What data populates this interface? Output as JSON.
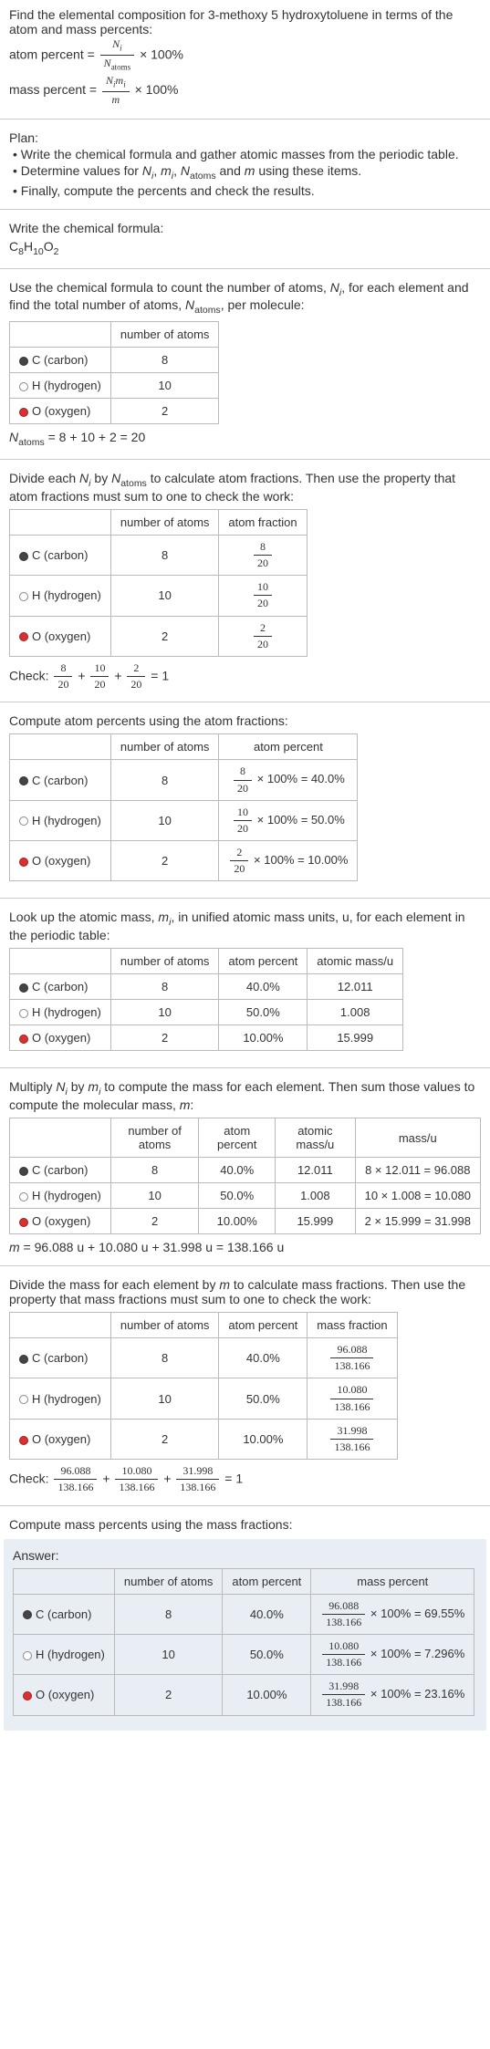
{
  "intro": {
    "line1": "Find the elemental composition for 3-methoxy 5 hydroxytoluene in terms of the atom and mass percents:",
    "atom_percent_label": "atom percent = ",
    "atom_percent_times": " × 100%",
    "mass_percent_label": "mass percent = ",
    "mass_percent_times": " × 100%",
    "Ni": "N",
    "Ni_sub": "i",
    "Natoms": "N",
    "Natoms_sub": "atoms",
    "Nimi_top": "N",
    "Nimi_top_sub": "i",
    "Nimi_top2": "m",
    "Nimi_top2_sub": "i",
    "m": "m"
  },
  "plan": {
    "title": "Plan:",
    "b1": "• Write the chemical formula and gather atomic masses from the periodic table.",
    "b2_a": "• Determine values for ",
    "b2_b": " using these items.",
    "b3": "• Finally, compute the percents and check the results."
  },
  "write_formula": {
    "title": "Write the chemical formula:",
    "formula_c": "C",
    "formula_c_n": "8",
    "formula_h": "H",
    "formula_h_n": "10",
    "formula_o": "O",
    "formula_o_n": "2"
  },
  "count_atoms": {
    "text_a": "Use the chemical formula to count the number of atoms, ",
    "text_b": ", for each element and find the total number of atoms, ",
    "text_c": ", per molecule:",
    "header_num": "number of atoms",
    "rows": [
      {
        "el": "C (carbon)",
        "n": "8"
      },
      {
        "el": "H (hydrogen)",
        "n": "10"
      },
      {
        "el": "O (oxygen)",
        "n": "2"
      }
    ],
    "sum_label": " = 8 + 10 + 2 = 20"
  },
  "atom_frac": {
    "text_a": "Divide each ",
    "text_b": " by ",
    "text_c": " to calculate atom fractions. Then use the property that atom fractions must sum to one to check the work:",
    "header_num": "number of atoms",
    "header_frac": "atom fraction",
    "rows": [
      {
        "el": "C (carbon)",
        "n": "8",
        "num": "8",
        "den": "20"
      },
      {
        "el": "H (hydrogen)",
        "n": "10",
        "num": "10",
        "den": "20"
      },
      {
        "el": "O (oxygen)",
        "n": "2",
        "num": "2",
        "den": "20"
      }
    ],
    "check_label": "Check: ",
    "check_eq": " = 1"
  },
  "atom_pct": {
    "title": "Compute atom percents using the atom fractions:",
    "header_num": "number of atoms",
    "header_pct": "atom percent",
    "rows": [
      {
        "el": "C (carbon)",
        "n": "8",
        "num": "8",
        "den": "20",
        "res": " × 100% = 40.0%"
      },
      {
        "el": "H (hydrogen)",
        "n": "10",
        "num": "10",
        "den": "20",
        "res": " × 100% = 50.0%"
      },
      {
        "el": "O (oxygen)",
        "n": "2",
        "num": "2",
        "den": "20",
        "res": " × 100% = 10.00%"
      }
    ]
  },
  "atomic_mass": {
    "text_a": "Look up the atomic mass, ",
    "text_b": ", in unified atomic mass units, u, for each element in the periodic table:",
    "header_num": "number of atoms",
    "header_pct": "atom percent",
    "header_mass": "atomic mass/u",
    "rows": [
      {
        "el": "C (carbon)",
        "n": "8",
        "pct": "40.0%",
        "mass": "12.011"
      },
      {
        "el": "H (hydrogen)",
        "n": "10",
        "pct": "50.0%",
        "mass": "1.008"
      },
      {
        "el": "O (oxygen)",
        "n": "2",
        "pct": "10.00%",
        "mass": "15.999"
      }
    ]
  },
  "mass_calc": {
    "text_a": "Multiply ",
    "text_b": " by ",
    "text_c": " to compute the mass for each element. Then sum those values to compute the molecular mass, ",
    "text_d": ":",
    "header_num": "number of atoms",
    "header_pct": "atom percent",
    "header_amass": "atomic mass/u",
    "header_massu": "mass/u",
    "rows": [
      {
        "el": "C (carbon)",
        "n": "8",
        "pct": "40.0%",
        "amass": "12.011",
        "calc": "8 × 12.011 = 96.088"
      },
      {
        "el": "H (hydrogen)",
        "n": "10",
        "pct": "50.0%",
        "amass": "1.008",
        "calc": "10 × 1.008 = 10.080"
      },
      {
        "el": "O (oxygen)",
        "n": "2",
        "pct": "10.00%",
        "amass": "15.999",
        "calc": "2 × 15.999 = 31.998"
      }
    ],
    "sum": " = 96.088 u + 10.080 u + 31.998 u = 138.166 u"
  },
  "mass_frac": {
    "text_a": "Divide the mass for each element by ",
    "text_b": " to calculate mass fractions. Then use the property that mass fractions must sum to one to check the work:",
    "header_num": "number of atoms",
    "header_pct": "atom percent",
    "header_frac": "mass fraction",
    "rows": [
      {
        "el": "C (carbon)",
        "n": "8",
        "pct": "40.0%",
        "num": "96.088",
        "den": "138.166"
      },
      {
        "el": "H (hydrogen)",
        "n": "10",
        "pct": "50.0%",
        "num": "10.080",
        "den": "138.166"
      },
      {
        "el": "O (oxygen)",
        "n": "2",
        "pct": "10.00%",
        "num": "31.998",
        "den": "138.166"
      }
    ],
    "check_label": "Check: ",
    "check_eq": " = 1"
  },
  "final": {
    "title": "Compute mass percents using the mass fractions:",
    "answer_label": "Answer:",
    "header_num": "number of atoms",
    "header_pct": "atom percent",
    "header_mass": "mass percent",
    "rows": [
      {
        "el": "C (carbon)",
        "n": "8",
        "pct": "40.0%",
        "num": "96.088",
        "den": "138.166",
        "res": " × 100% = 69.55%"
      },
      {
        "el": "H (hydrogen)",
        "n": "10",
        "pct": "50.0%",
        "num": "10.080",
        "den": "138.166",
        "res": " × 100% = 7.296%"
      },
      {
        "el": "O (oxygen)",
        "n": "2",
        "pct": "10.00%",
        "num": "31.998",
        "den": "138.166",
        "res": " × 100% = 23.16%"
      }
    ]
  },
  "chart_data": {
    "type": "table",
    "title": "Elemental composition of 3-methoxy 5 hydroxytoluene (C8H10O2)",
    "molecular_mass_u": 138.166,
    "elements": [
      {
        "symbol": "C",
        "name": "carbon",
        "atoms": 8,
        "atom_fraction": 0.4,
        "atom_percent": 40.0,
        "atomic_mass_u": 12.011,
        "mass_u": 96.088,
        "mass_fraction": 0.6955,
        "mass_percent": 69.55
      },
      {
        "symbol": "H",
        "name": "hydrogen",
        "atoms": 10,
        "atom_fraction": 0.5,
        "atom_percent": 50.0,
        "atomic_mass_u": 1.008,
        "mass_u": 10.08,
        "mass_fraction": 0.07296,
        "mass_percent": 7.296
      },
      {
        "symbol": "O",
        "name": "oxygen",
        "atoms": 2,
        "atom_fraction": 0.1,
        "atom_percent": 10.0,
        "atomic_mass_u": 15.999,
        "mass_u": 31.998,
        "mass_fraction": 0.2316,
        "mass_percent": 23.16
      }
    ],
    "total_atoms": 20
  }
}
